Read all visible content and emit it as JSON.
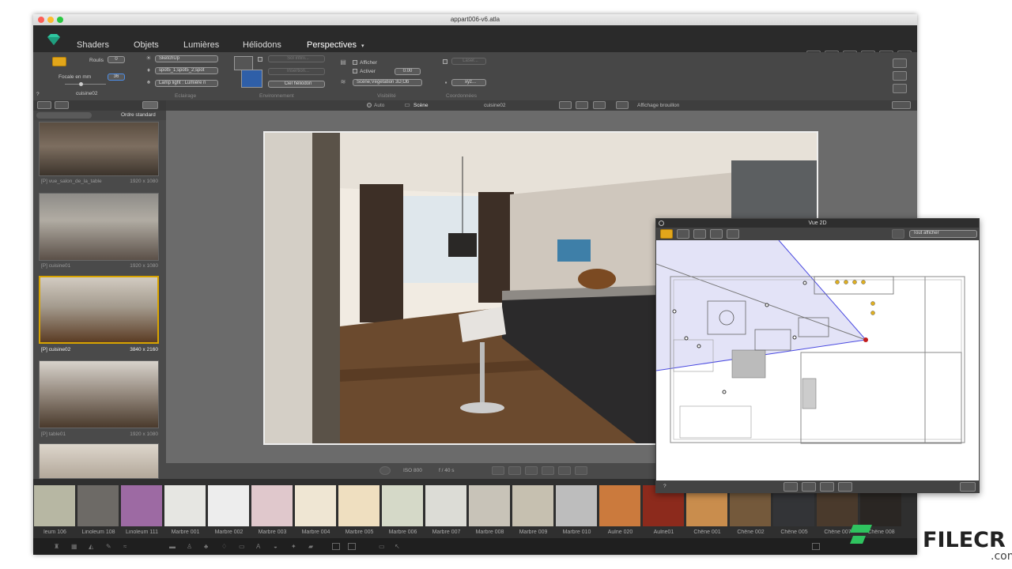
{
  "window": {
    "title": "appart006-v6.atla"
  },
  "menu": {
    "items": [
      "Shaders",
      "Objets",
      "Lumières",
      "Héliodons",
      "Perspectives"
    ],
    "selected": "Perspectives"
  },
  "ribbon": {
    "camera": {
      "roulis_label": "Roulis",
      "roulis_value": "0",
      "focale_label": "Focale en mm",
      "focale_value": "36",
      "name": "cuisine02"
    },
    "eclairage": {
      "section": "Eclairage",
      "sun": "SketchUp",
      "spots": "spot5_1;spot5_2;spot",
      "lamp": "Lamp light : Lumière n"
    },
    "environnement": {
      "section": "Environnement",
      "btn1": "Sol infini...",
      "btn2": "Insertion...",
      "btn3": "Ciel héliodon"
    },
    "visibilite": {
      "section": "Visibilité",
      "afficher": "Afficher",
      "activer": "Activer",
      "value": "0.00",
      "dropdown": "Scène;Végétation 3D;Ob"
    },
    "coordonnees": {
      "section": "Coordonnées",
      "laser": "Laser...",
      "xyz": "xyz..."
    }
  },
  "sidebar": {
    "sort": "Ordre standard",
    "items": [
      {
        "name": "[P] vue_salon_de_la_table",
        "size": "1920 x 1080",
        "selected": false
      },
      {
        "name": "[P] cuisine01",
        "size": "1920 x 1080",
        "selected": false
      },
      {
        "name": "[P] cuisine02",
        "size": "3840 x 2160",
        "selected": true
      },
      {
        "name": "[P] table01",
        "size": "1920 x 1080",
        "selected": false
      }
    ]
  },
  "viewhead": {
    "auto": "Auto",
    "scene": "Scène",
    "name": "cuisine02",
    "mode": "Affichage brouillon"
  },
  "viewfoot": {
    "iso": "ISO 800",
    "aperture": "f / 40 s"
  },
  "materials": {
    "colors": [
      "#b7b7a3",
      "#6d6a66",
      "#9d6aa3",
      "#e6e6e2",
      "#ededed",
      "#e0c8cc",
      "#efe6d3",
      "#efdfc0",
      "#d5d9c8",
      "#dcdcd6",
      "#c8c3b8",
      "#c6c0b0",
      "#bdbdbd",
      "#cb7a3d",
      "#8c2a1c",
      "#c98d4d",
      "#74593b",
      "#333437",
      "#4a3a2c",
      "#2a2623"
    ],
    "labels": [
      "leum 106",
      "Linoleum 108",
      "Linoleum 111",
      "Marbre 001",
      "Marbre 002",
      "Marbre 003",
      "Marbre 004",
      "Marbre 005",
      "Marbre 006",
      "Marbre 007",
      "Marbre 008",
      "Marbre 009",
      "Marbre 010",
      "Aulne 020",
      "Aulne01",
      "Chêne 001",
      "Chêne 002",
      "Chêne 005",
      "Chêne 007",
      "Chêne 008"
    ]
  },
  "vue2d": {
    "title": "Vue 2D",
    "dropdown": "Tout afficher",
    "help": "?"
  },
  "help": "?",
  "watermark": {
    "text": "FILECR",
    "suffix": ".com"
  }
}
